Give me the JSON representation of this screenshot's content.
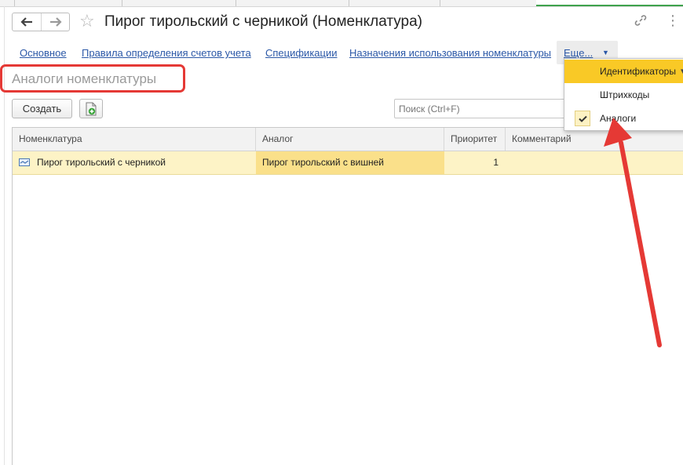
{
  "window": {
    "title": "Пирог тирольский с черникой (Номенклатура)"
  },
  "nav_links": [
    "Основное",
    "Правила определения счетов учета",
    "Спецификации",
    "Назначения использования номенклатуры"
  ],
  "more_button": {
    "label": "Еще..."
  },
  "section_title": "Аналоги номенклатуры",
  "toolbar": {
    "create_label": "Создать",
    "search_placeholder": "Поиск (Ctrl+F)"
  },
  "table": {
    "columns": [
      "Номенклатура",
      "Аналог",
      "Приоритет",
      "Комментарий"
    ],
    "rows": [
      {
        "nomenclature": "Пирог тирольский с черникой",
        "analog": "Пирог тирольский с вишней",
        "priority": "1",
        "comment": ""
      }
    ]
  },
  "dropdown": {
    "items": [
      {
        "label": "Идентификаторы",
        "highlighted": true,
        "has_submenu": true,
        "checked": false
      },
      {
        "label": "Штрихкоды",
        "highlighted": false,
        "has_submenu": false,
        "checked": false
      },
      {
        "label": "Аналоги",
        "highlighted": false,
        "has_submenu": false,
        "checked": true
      }
    ],
    "submenu_glyph": "▾"
  },
  "colors": {
    "accent_link": "#2b58a7",
    "row_selected": "#fdf3c6",
    "menu_highlight": "#f9c926",
    "annotation_red": "#e53935"
  },
  "icons": [
    "back-arrow-icon",
    "forward-arrow-icon",
    "favorite-star-icon",
    "link-icon",
    "more-vertical-icon",
    "excel-add-icon",
    "nomenclature-item-icon",
    "checkmark-icon",
    "chevron-down-icon"
  ]
}
